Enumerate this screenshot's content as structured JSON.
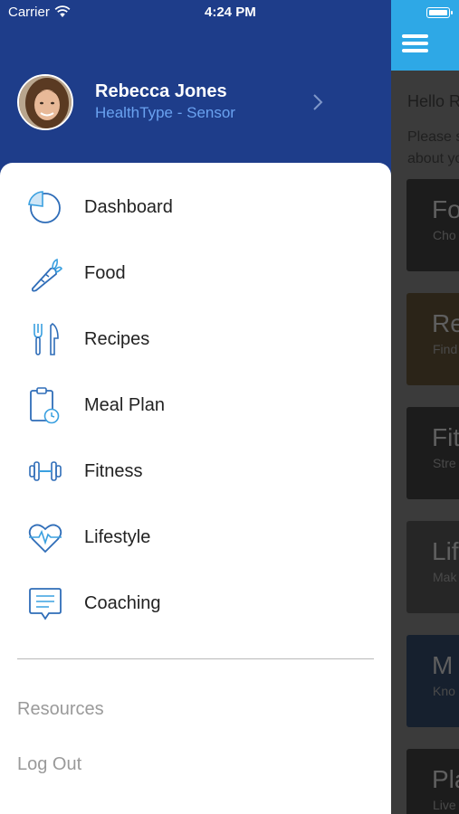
{
  "status_bar": {
    "carrier": "Carrier",
    "time": "4:24 PM"
  },
  "profile": {
    "name": "Rebecca Jones",
    "health_type": "HealthType - Sensor"
  },
  "menu": {
    "items": [
      {
        "label": "Dashboard",
        "icon": "pie-chart-icon"
      },
      {
        "label": "Food",
        "icon": "carrot-icon"
      },
      {
        "label": "Recipes",
        "icon": "fork-knife-icon"
      },
      {
        "label": "Meal Plan",
        "icon": "clipboard-clock-icon"
      },
      {
        "label": "Fitness",
        "icon": "dumbbell-icon"
      },
      {
        "label": "Lifestyle",
        "icon": "heart-pulse-icon"
      },
      {
        "label": "Coaching",
        "icon": "chat-bubble-icon"
      }
    ],
    "secondary": [
      {
        "label": "Resources"
      },
      {
        "label": "Log Out"
      }
    ]
  },
  "background_screen": {
    "greeting": "Hello R",
    "intro_line1": "Please s",
    "intro_line2": "about yo",
    "cards": [
      {
        "title": "Fo",
        "subtitle": "Cho"
      },
      {
        "title": "Re",
        "subtitle": "Find"
      },
      {
        "title": "Fit",
        "subtitle": "Stre"
      },
      {
        "title": "Lif",
        "subtitle": "Mak"
      },
      {
        "title": "M",
        "subtitle": "Kno"
      },
      {
        "title": "Pla",
        "subtitle": "Live"
      }
    ]
  },
  "colors": {
    "drawer_header": "#1e3d8a",
    "accent": "#2ea8e6",
    "profile_subtitle": "#6aa2f0",
    "icon_blue": "#2f6db8",
    "icon_light": "#3aa0e0"
  }
}
